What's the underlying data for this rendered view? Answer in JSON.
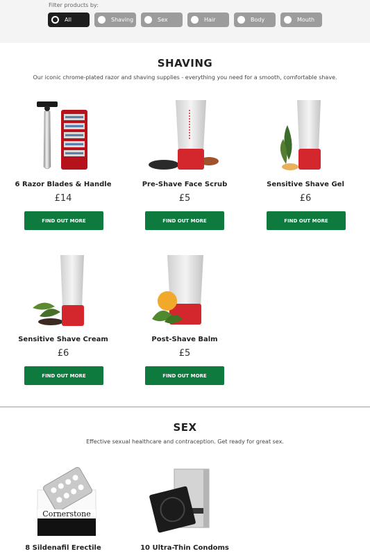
{
  "filter": {
    "label": "Filter products by:",
    "options": [
      {
        "label": "All",
        "active": true
      },
      {
        "label": "Shaving",
        "active": false
      },
      {
        "label": "Sex",
        "active": false
      },
      {
        "label": "Hair",
        "active": false
      },
      {
        "label": "Body",
        "active": false
      },
      {
        "label": "Mouth",
        "active": false
      }
    ]
  },
  "shaving": {
    "title": "SHAVING",
    "description": "Our iconic chrome-plated razor and shaving supplies - everything you need for a smooth, comfortable shave.",
    "products": [
      {
        "name": "6 Razor Blades & Handle",
        "price": "£14",
        "button": "FIND OUT MORE"
      },
      {
        "name": "Pre-Shave Face Scrub",
        "price": "£5",
        "button": "FIND OUT MORE"
      },
      {
        "name": "Sensitive Shave Gel",
        "price": "£6",
        "button": "FIND OUT MORE"
      },
      {
        "name": "Sensitive Shave Cream",
        "price": "£6",
        "button": "FIND OUT MORE"
      },
      {
        "name": "Post-Shave Balm",
        "price": "£5",
        "button": "FIND OUT MORE"
      }
    ]
  },
  "sex": {
    "title": "SEX",
    "description": "Effective sexual healthcare and contraception. Get ready for great sex.",
    "products": [
      {
        "name": "8 Sildenafil Erectile",
        "brand": "Cornerstone"
      },
      {
        "name": "10 Ultra-Thin Condoms"
      }
    ]
  },
  "colors": {
    "button_green": "#0e7a3e",
    "pill_active": "#1e1e1e",
    "pill_inactive": "#9c9c9c",
    "tube_red": "#d4262d"
  }
}
